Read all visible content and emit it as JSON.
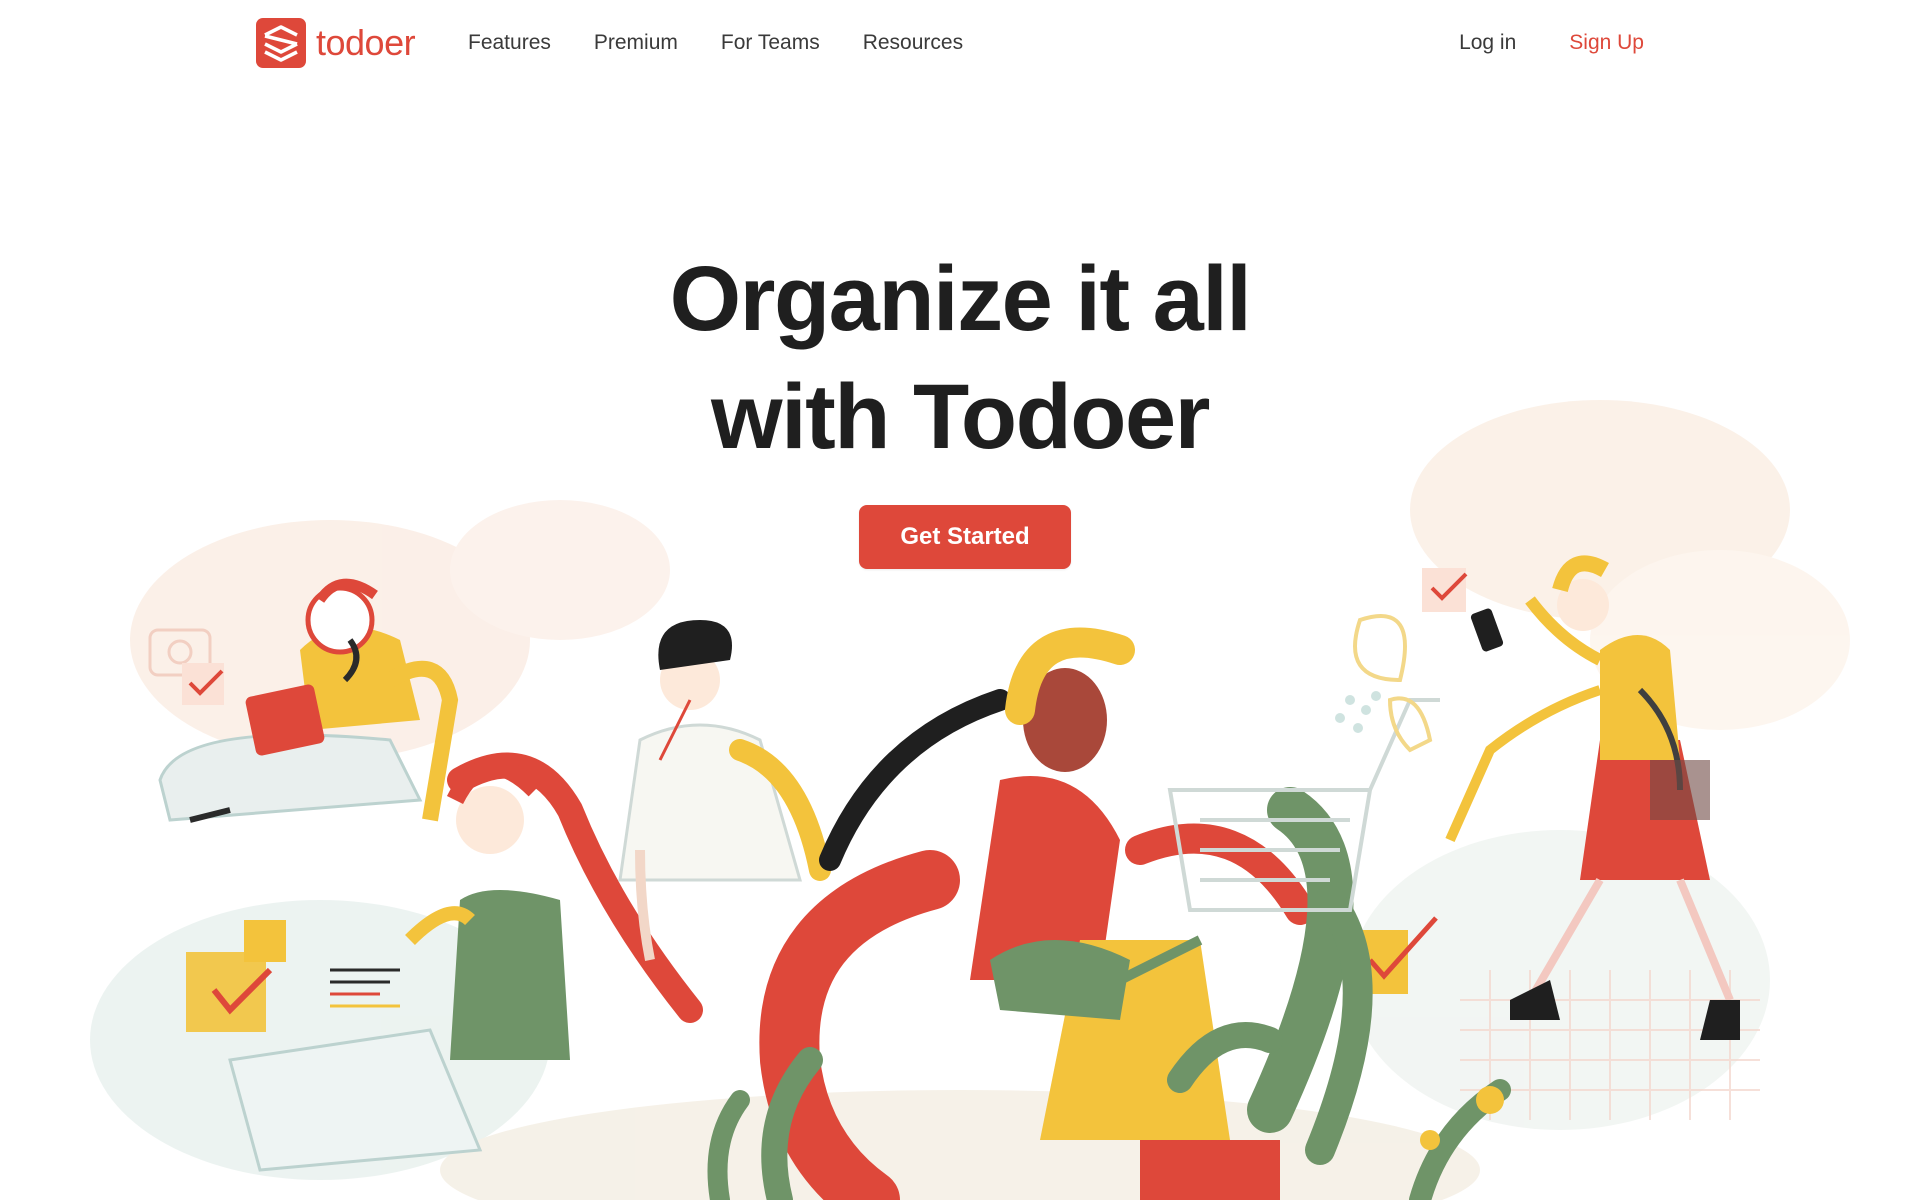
{
  "brand": {
    "name": "todoer",
    "logo_icon": "stacked-layers-icon",
    "color": "#de483a"
  },
  "nav": {
    "links": [
      {
        "label": "Features"
      },
      {
        "label": "Premium"
      },
      {
        "label": "For Teams"
      },
      {
        "label": "Resources"
      }
    ],
    "login_label": "Log in",
    "signup_label": "Sign Up"
  },
  "hero": {
    "title_line1": "Organize it all",
    "title_line2": "with Todoer",
    "cta_label": "Get Started"
  },
  "colors": {
    "accent": "#de483a",
    "yellow": "#f3c33c",
    "green": "#6f9468",
    "pale_blue": "#cfe3e0",
    "text": "#1f1f1f"
  }
}
